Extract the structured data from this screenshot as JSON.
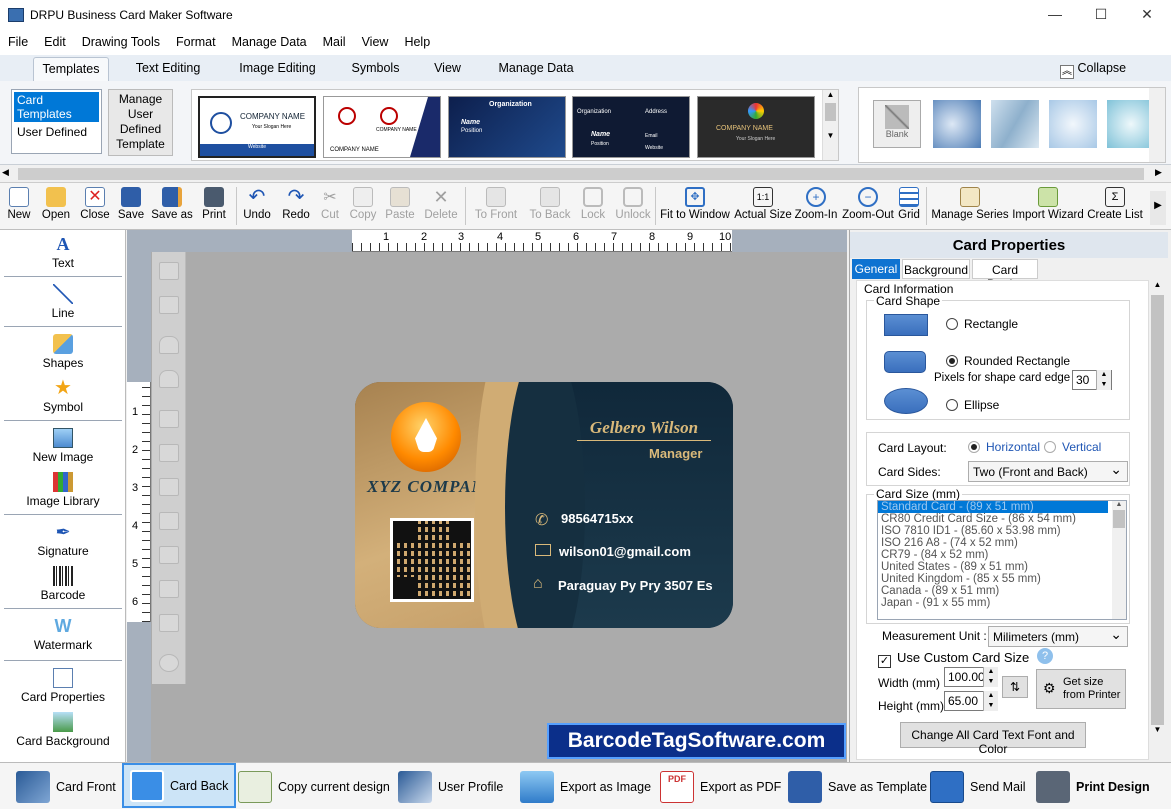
{
  "window": {
    "title": "DRPU Business Card Maker Software",
    "minimize": "—",
    "maximize": "☐",
    "close": "✕"
  },
  "menu": [
    "File",
    "Edit",
    "Drawing Tools",
    "Format",
    "Manage Data",
    "Mail",
    "View",
    "Help"
  ],
  "ribbon_tabs": [
    "Templates",
    "Text Editing",
    "Image Editing",
    "Symbols",
    "View",
    "Manage Data"
  ],
  "collapse": "Collapse",
  "template_categories": [
    "Card Templates",
    "User Defined"
  ],
  "manage_template": "Manage User Defined Template",
  "templates": [
    {
      "company": "COMPANY NAME",
      "slogan": "Your Slogan Here",
      "extra": "Website"
    },
    {
      "company": "COMPANY NAME",
      "slogan": "",
      "extra": ""
    },
    {
      "company": "Organization",
      "slogan": "Name",
      "extra": "Position"
    },
    {
      "company": "Organization",
      "slogan": "Name",
      "extra": "Position"
    },
    {
      "company": "COMPANY NAME",
      "slogan": "Your Slogan Here",
      "extra": ""
    }
  ],
  "template_extra": {
    "t2_mid": "COMPANY NAME",
    "t4_address": "Address",
    "t4_email": "Email",
    "t4_website": "Website"
  },
  "bg_blank": "Blank",
  "toolbar": [
    "New",
    "Open",
    "Close",
    "Save",
    "Save as",
    "Print",
    "Undo",
    "Redo",
    "Cut",
    "Copy",
    "Paste",
    "Delete",
    "To Front",
    "To Back",
    "Lock",
    "Unlock",
    "Fit to Window",
    "Actual Size",
    "Zoom-In",
    "Zoom-Out",
    "Grid",
    "Manage Series",
    "Import Wizard",
    "Create List"
  ],
  "left_tools": [
    "Text",
    "Line",
    "Shapes",
    "Symbol",
    "New Image",
    "Image Library",
    "Signature",
    "Barcode",
    "Watermark",
    "Card Properties",
    "Card Background"
  ],
  "ruler_h": [
    "1",
    "2",
    "3",
    "4",
    "5",
    "6",
    "7",
    "8",
    "9",
    "10"
  ],
  "ruler_v": [
    "1",
    "2",
    "3",
    "4",
    "5",
    "6"
  ],
  "card": {
    "name": "Gelbero Wilson",
    "title": "Manager",
    "company": "XYZ COMPANY",
    "phone": "98564715xx",
    "email": "wilson01@gmail.com",
    "address": "Paraguay Py Pry 3507 Es"
  },
  "props": {
    "header": "Card Properties",
    "tabs": [
      "General",
      "Background",
      "Card Border"
    ],
    "card_information": "Card Information",
    "card_shape": "Card Shape",
    "rectangle": "Rectangle",
    "rounded_rectangle": "Rounded Rectangle",
    "pixels_label": "Pixels for shape card edge :",
    "pixels_value": "30",
    "ellipse": "Ellipse",
    "card_layout": "Card Layout:",
    "horizontal": "Horizontal",
    "vertical": "Vertical",
    "card_sides": "Card Sides:",
    "card_sides_value": "Two (Front and Back)",
    "card_size": "Card Size (mm)",
    "sizes": [
      "Standard Card  -  (89 x 51 mm)",
      "CR80 Credit Card Size  -  (86 x 54 mm)",
      "ISO 7810 ID1  -  (85.60 x 53.98 mm)",
      "ISO 216  A8  -  (74 x 52 mm)",
      "CR79  -  (84 x 52 mm)",
      "United States  -  (89 x 51 mm)",
      "United Kingdom  -  (85 x 55 mm)",
      "Canada  -  (89 x 51 mm)",
      "Japan  -  (91 x 55 mm)"
    ],
    "measurement_unit": "Measurement Unit :",
    "measurement_value": "Milimeters (mm)",
    "use_custom": "Use Custom Card Size",
    "width_label": "Width   (mm)",
    "width_value": "100.00",
    "height_label": "Height  (mm)",
    "height_value": "65.00",
    "get_size": "Get size from Printer",
    "change_all": "Change All Card Text Font and Color"
  },
  "watermark_brand": "BarcodeTagSoftware.com",
  "bottom": [
    "Card Front",
    "Card Back",
    "Copy current design",
    "User Profile",
    "Export as Image",
    "Export as PDF",
    "Save as Template",
    "Send Mail",
    "Print Design"
  ],
  "colors": {
    "accent": "#3399ff",
    "card_dark": "#172b3a",
    "card_gold": "#c4a16a",
    "select": "#0078d7"
  }
}
